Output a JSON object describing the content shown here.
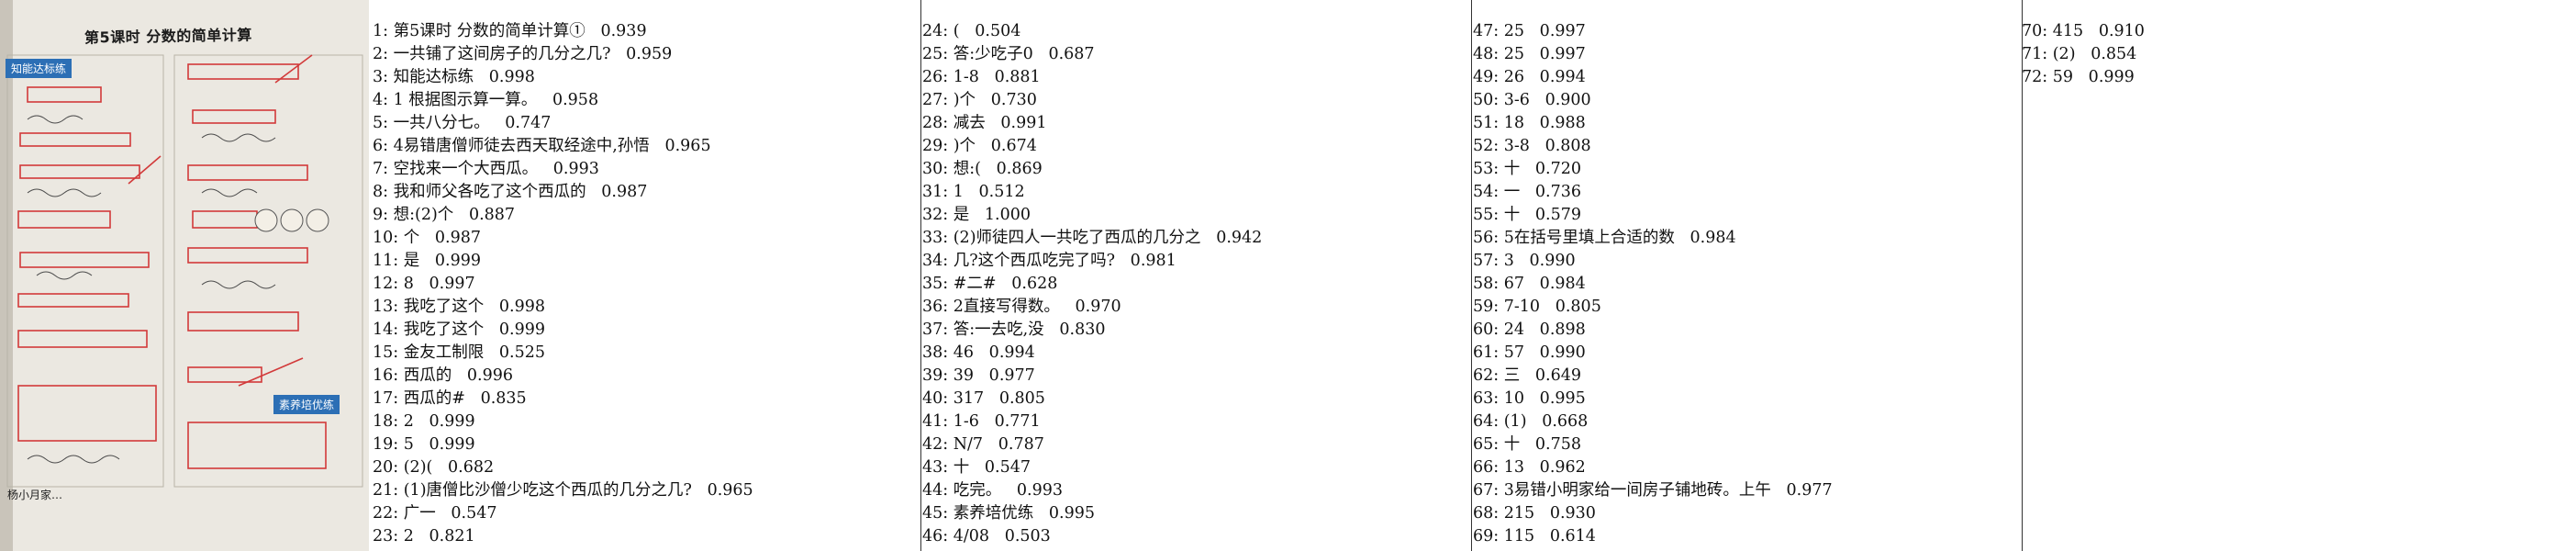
{
  "photo": {
    "title": "第5课时 分数的简单计算",
    "badge_top": "知能达标练",
    "badge_bottom": "素养培优练",
    "footer": "杨小月家…"
  },
  "columns": [
    [
      "1: 第5课时 分数的简单计算①   0.939",
      "2: 一共铺了这间房子的几分之几?   0.959",
      "3: 知能达标练   0.998",
      "4: 1 根据图示算一算。   0.958",
      "5: 一共八分七。   0.747",
      "6: 4易错唐僧师徒去西天取经途中,孙悟   0.965",
      "7: 空找来一个大西瓜。   0.993",
      "8: 我和师父各吃了这个西瓜的   0.987",
      "9: 想:(2)个   0.887",
      "10: 个   0.987",
      "11: 是   0.999",
      "12: 8   0.997",
      "13: 我吃了这个   0.998",
      "14: 我吃了这个   0.999",
      "15: 金友工制限   0.525",
      "16: 西瓜的   0.996",
      "17: 西瓜的#   0.835",
      "18: 2   0.999",
      "19: 5   0.999",
      "20: (2)(   0.682",
      "21: (1)唐僧比沙僧少吃这个西瓜的几分之几?   0.965",
      "22: 广一   0.547",
      "23: 2   0.821"
    ],
    [
      "24: (   0.504",
      "25: 答:少吃子0   0.687",
      "26: 1-8   0.881",
      "27: )个   0.730",
      "28: 减去   0.991",
      "29: )个   0.674",
      "30: 想:(   0.869",
      "31: 1   0.512",
      "32: 是   1.000",
      "33: (2)师徒四人一共吃了西瓜的几分之   0.942",
      "34: 几?这个西瓜吃完了吗?   0.981",
      "35: #二#   0.628",
      "36: 2直接写得数。   0.970",
      "37: 答:一去吃,没   0.830",
      "38: 46   0.994",
      "39: 39   0.977",
      "40: 317   0.805",
      "41: 1-6   0.771",
      "42: N/7   0.787",
      "43: 十   0.547",
      "44: 吃完。   0.993",
      "45: 素养培优练   0.995",
      "46: 4/08   0.503"
    ],
    [
      "47: 25   0.997",
      "48: 25   0.997",
      "49: 26   0.994",
      "50: 3-6   0.900",
      "51: 18   0.988",
      "52: 3-8   0.808",
      "53: 十   0.720",
      "54: 一   0.736",
      "55: 十   0.579",
      "56: 5在括号里填上合适的数   0.984",
      "57: 3   0.990",
      "58: 67   0.984",
      "59: 7-10   0.805",
      "60: 24   0.898",
      "61: 57   0.990",
      "62: 三   0.649",
      "63: 10   0.995",
      "64: (1)   0.668",
      "65: 十   0.758",
      "66: 13   0.962",
      "67: 3易错小明家给一间房子铺地砖。上午   0.977",
      "68: 215   0.930",
      "69: 115   0.614"
    ],
    [
      "70: 415   0.910",
      "71: (2)   0.854",
      "72: 59   0.999"
    ]
  ]
}
